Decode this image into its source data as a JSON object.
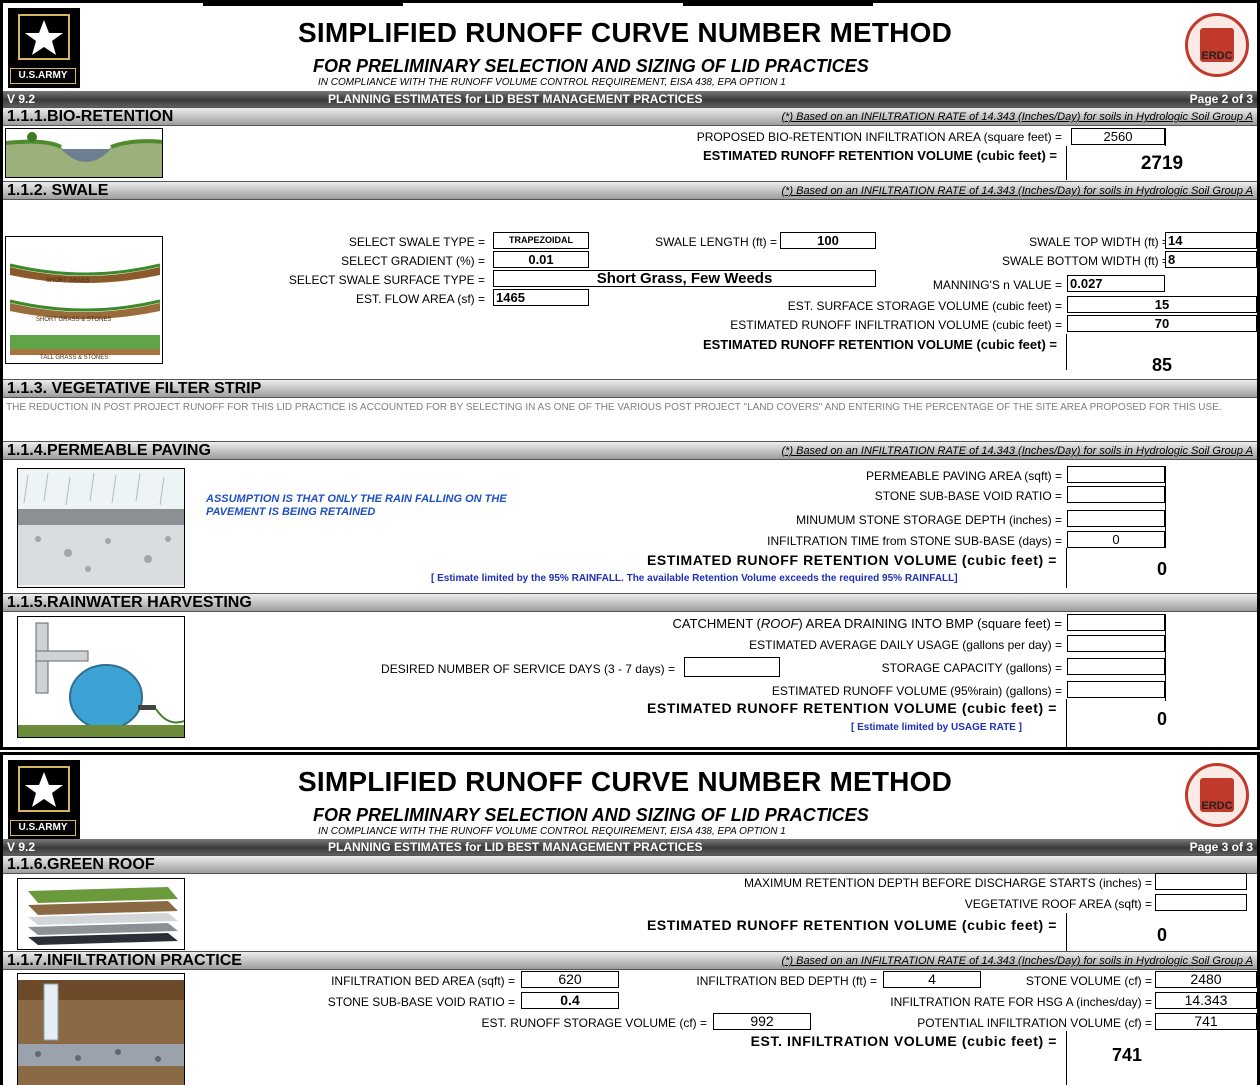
{
  "header": {
    "title": "SIMPLIFIED RUNOFF CURVE NUMBER METHOD",
    "subtitle": "FOR PRELIMINARY SELECTION AND SIZING OF LID PRACTICES",
    "compliance": "IN COMPLIANCE WITH THE RUNOFF VOLUME CONTROL REQUIREMENT, EISA 438, EPA OPTION 1",
    "version": "V 9.2",
    "planning": "PLANNING ESTIMATES for LID BEST MANAGEMENT PRACTICES",
    "army_logo_text": "U.S.ARMY",
    "erdc_logo_text": "ERDC",
    "colors": {
      "bar_dark": "#3a3a3a",
      "section_grey": "#bcbcbc",
      "note_blue": "#1f4fc4",
      "seal_red": "#c0392b"
    },
    "icons": [
      "army-star-logo",
      "erdc-seal-logo"
    ]
  },
  "page2": {
    "page_label": "Page 2 of 3",
    "bio": {
      "title": "1.1.1.BIO-RETENTION",
      "note": "(*)  Based on an INFILTRATION RATE of 14.343 (Inches/Day) for soils in Hydrologic Soil Group A",
      "area_label": "PROPOSED BIO-RETENTION INFILTRATION AREA (square feet) =",
      "area_value": "2560",
      "volume_label": "ESTIMATED RUNOFF RETENTION VOLUME (cubic feet) =",
      "volume_value": "2719"
    },
    "swale": {
      "title": "1.1.2. SWALE",
      "note": "(*)  Based on an INFILTRATION RATE of 14.343 (Inches/Day) for soils in Hydrologic Soil Group A",
      "type_label": "SELECT SWALE TYPE =",
      "type_value": "TRAPEZOIDAL",
      "gradient_label": "SELECT GRADIENT (%) =",
      "gradient_value": "0.01",
      "surface_label": "SELECT SWALE SURFACE TYPE =",
      "surface_value": "Short Grass, Few Weeds",
      "flow_label": "EST. FLOW AREA (sf) =",
      "flow_value": "1465",
      "length_label": "SWALE LENGTH (ft) =",
      "length_value": "100",
      "top_label": "SWALE TOP WIDTH (ft) =",
      "top_value": "14",
      "bottom_label": "SWALE BOTTOM WIDTH (ft) =",
      "bottom_value": "8",
      "manning_label": "MANNING'S n VALUE =",
      "manning_value": "0.027",
      "surface_storage_label": "EST. SURFACE STORAGE VOLUME (cubic feet) =",
      "surface_storage_value": "15",
      "infiltration_label": "ESTIMATED RUNOFF INFILTRATION VOLUME (cubic feet) =",
      "infiltration_value": "70",
      "volume_label": "ESTIMATED RUNOFF RETENTION VOLUME (cubic feet) =",
      "volume_value": "85",
      "img_labels": [
        "SHORT GRASS",
        "SHORT GRASS & STONES",
        "TALL GRASS & STONES"
      ]
    },
    "vfs": {
      "title": "1.1.3. VEGETATIVE FILTER STRIP",
      "text": "THE REDUCTION IN POST PROJECT RUNOFF FOR THIS LID PRACTICE IS ACCOUNTED FOR BY SELECTING IN AS ONE OF THE VARIOUS POST PROJECT \"LAND COVERS\" AND ENTERING THE PERCENTAGE OF THE SITE AREA PROPOSED FOR THIS USE."
    },
    "paving": {
      "title": "1.1.4.PERMEABLE PAVING",
      "note": "(*)  Based on an INFILTRATION RATE of 14.343 (Inches/Day) for soils in Hydrologic Soil Group A",
      "assumption_1": "ASSUMPTION IS THAT ONLY THE RAIN FALLING ON THE",
      "assumption_2": "PAVEMENT IS BEING RETAINED",
      "area_label": "PERMEABLE PAVING AREA (sqft) =",
      "void_label": "STONE SUB-BASE VOID RATIO =",
      "depth_label": "MINUMUM STONE STORAGE DEPTH (inches) =",
      "time_label": "INFILTRATION TIME from STONE SUB-BASE (days) =",
      "time_value": "0",
      "volume_label": "ESTIMATED RUNOFF RETENTION VOLUME (cubic feet) =",
      "volume_value": "0",
      "limit_note": "[ Estimate limited by the 95% RAINFALL. The available Retention Volume exceeds the required 95% RAINFALL]"
    },
    "rain": {
      "title": "1.1.5.RAINWATER HARVESTING",
      "catch_label_a": "CATCHMENT (",
      "catch_label_roof": "ROOF",
      "catch_label_b": ")  AREA DRAINING INTO BMP (square feet) =",
      "usage_label": "ESTIMATED AVERAGE DAILY USAGE (gallons per day) =",
      "days_label": "DESIRED NUMBER OF SERVICE DAYS (3 - 7 days) =",
      "storage_label": "STORAGE CAPACITY (gallons) =",
      "runoff_label": "ESTIMATED RUNOFF VOLUME (95%rain) (gallons) =",
      "volume_label": "ESTIMATED RUNOFF RETENTION VOLUME (cubic feet) =",
      "volume_value": "0",
      "limit_note": "[ Estimate limited by USAGE RATE ]"
    }
  },
  "page3": {
    "page_label": "Page 3 of 3",
    "roof": {
      "title": "1.1.6.GREEN ROOF",
      "depth_label": "MAXIMUM RETENTION DEPTH BEFORE DISCHARGE STARTS (inches) =",
      "area_label": "VEGETATIVE ROOF AREA (sqft) =",
      "volume_label": "ESTIMATED RUNOFF RETENTION VOLUME (cubic feet) =",
      "volume_value": "0"
    },
    "infil": {
      "title": "1.1.7.INFILTRATION PRACTICE",
      "note": "(*)  Based on an INFILTRATION RATE of 14.343 (Inches/Day) for soils in Hydrologic Soil Group A",
      "area_label": "INFILTRATION BED AREA (sqft) =",
      "area_value": "620",
      "depth_label": "INFILTRATION BED DEPTH (ft) =",
      "depth_value": "4",
      "stone_label": "STONE VOLUME (cf) =",
      "stone_value": "2480",
      "void_label": "STONE SUB-BASE VOID RATIO =",
      "void_value": "0.4",
      "rate_label": "INFILTRATION RATE FOR HSG A (inches/day) =",
      "rate_value": "14.343",
      "storage_label": "EST. RUNOFF STORAGE VOLUME (cf) =",
      "storage_value": "992",
      "potential_label": "POTENTIAL INFILTRATION VOLUME (cf) =",
      "potential_value": "741",
      "volume_label": "EST. INFILTRATION VOLUME (cubic feet) =",
      "volume_value": "741"
    }
  }
}
